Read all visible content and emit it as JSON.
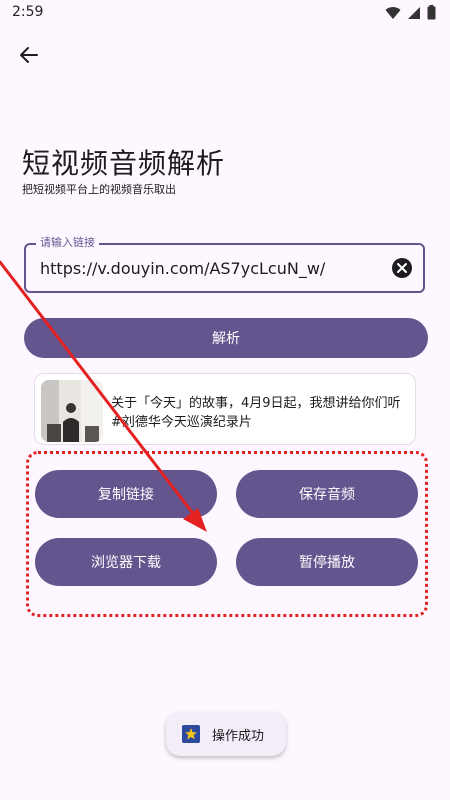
{
  "status_bar": {
    "time": "2:59"
  },
  "header": {
    "title": "短视频音频解析",
    "subtitle": "把短视频平台上的视频音乐取出"
  },
  "link_field": {
    "label": "请输入链接",
    "value": "https://v.douyin.com/AS7ycLcuN_w/"
  },
  "parse_button": {
    "label": "解析"
  },
  "result": {
    "title": "关于「今天」的故事，4月9日起，我想讲给你们听 #刘德华今天巡演纪录片"
  },
  "actions": {
    "copy_link": "复制链接",
    "save_audio": "保存音频",
    "browser_download": "浏览器下载",
    "pause_play": "暂停播放"
  },
  "toast": {
    "text": "操作成功"
  },
  "colors": {
    "primary": "#65558F",
    "background": "#FEF7FF",
    "annotation": "#E32121"
  }
}
